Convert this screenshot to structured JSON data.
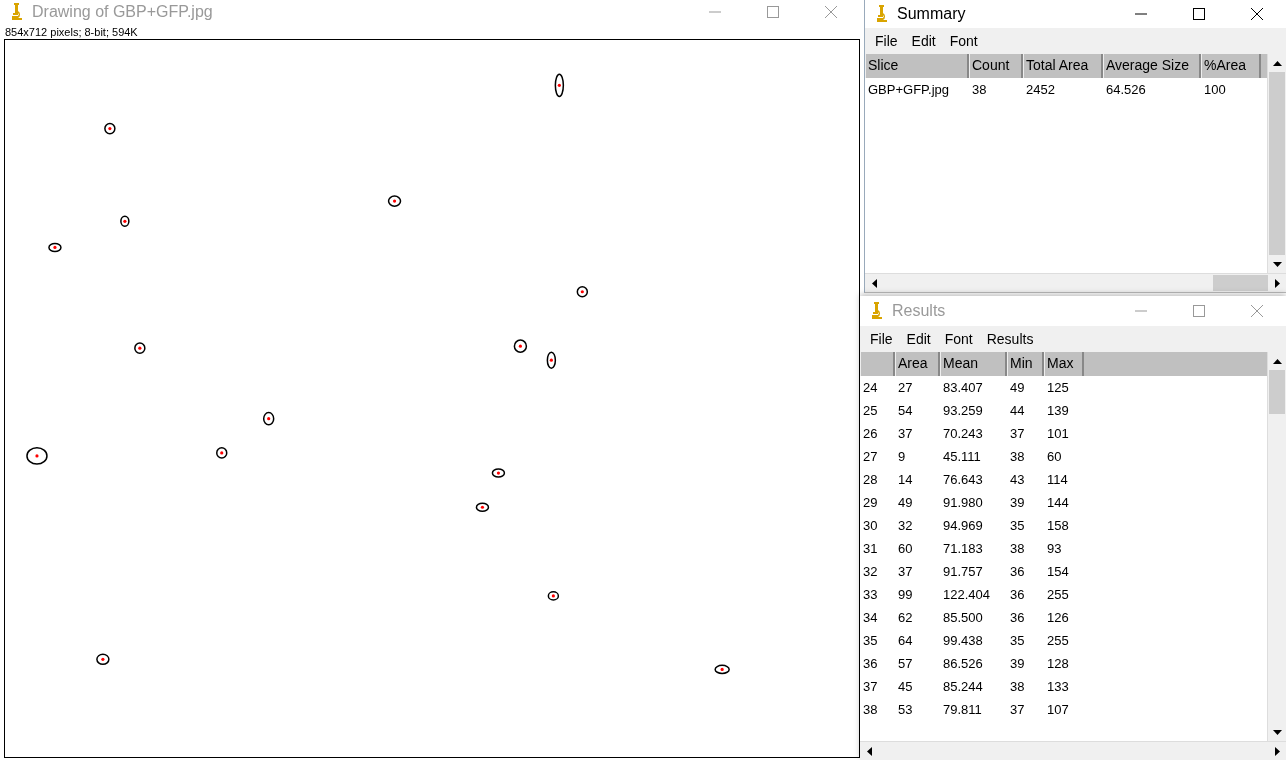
{
  "image_window": {
    "title": "Drawing of GBP+GFP.jpg",
    "active": false,
    "info": "854x712 pixels; 8-bit; 594K"
  },
  "summary_window": {
    "title": "Summary",
    "active": true,
    "menu": [
      "File",
      "Edit",
      "Font"
    ],
    "table": {
      "columns": [
        "Slice",
        "Count",
        "Total Area",
        "Average Size",
        "%Area"
      ],
      "rows": [
        [
          "GBP+GFP.jpg",
          "38",
          "2452",
          "64.526",
          "100"
        ]
      ]
    }
  },
  "results_window": {
    "title": "Results",
    "active": false,
    "menu": [
      "File",
      "Edit",
      "Font",
      "Results"
    ],
    "table": {
      "columns": [
        "",
        "Area",
        "Mean",
        "Min",
        "Max"
      ],
      "rows": [
        [
          "24",
          "27",
          "83.407",
          "49",
          "125"
        ],
        [
          "25",
          "54",
          "93.259",
          "44",
          "139"
        ],
        [
          "26",
          "37",
          "70.243",
          "37",
          "101"
        ],
        [
          "27",
          "9",
          "45.111",
          "38",
          "60"
        ],
        [
          "28",
          "14",
          "76.643",
          "43",
          "114"
        ],
        [
          "29",
          "49",
          "91.980",
          "39",
          "144"
        ],
        [
          "30",
          "32",
          "94.969",
          "35",
          "158"
        ],
        [
          "31",
          "60",
          "71.183",
          "38",
          "93"
        ],
        [
          "32",
          "37",
          "91.757",
          "36",
          "154"
        ],
        [
          "33",
          "99",
          "122.404",
          "36",
          "255"
        ],
        [
          "34",
          "62",
          "85.500",
          "36",
          "126"
        ],
        [
          "35",
          "64",
          "99.438",
          "35",
          "255"
        ],
        [
          "36",
          "57",
          "86.526",
          "39",
          "128"
        ],
        [
          "37",
          "45",
          "85.244",
          "38",
          "133"
        ],
        [
          "38",
          "53",
          "79.811",
          "37",
          "107"
        ]
      ]
    }
  }
}
